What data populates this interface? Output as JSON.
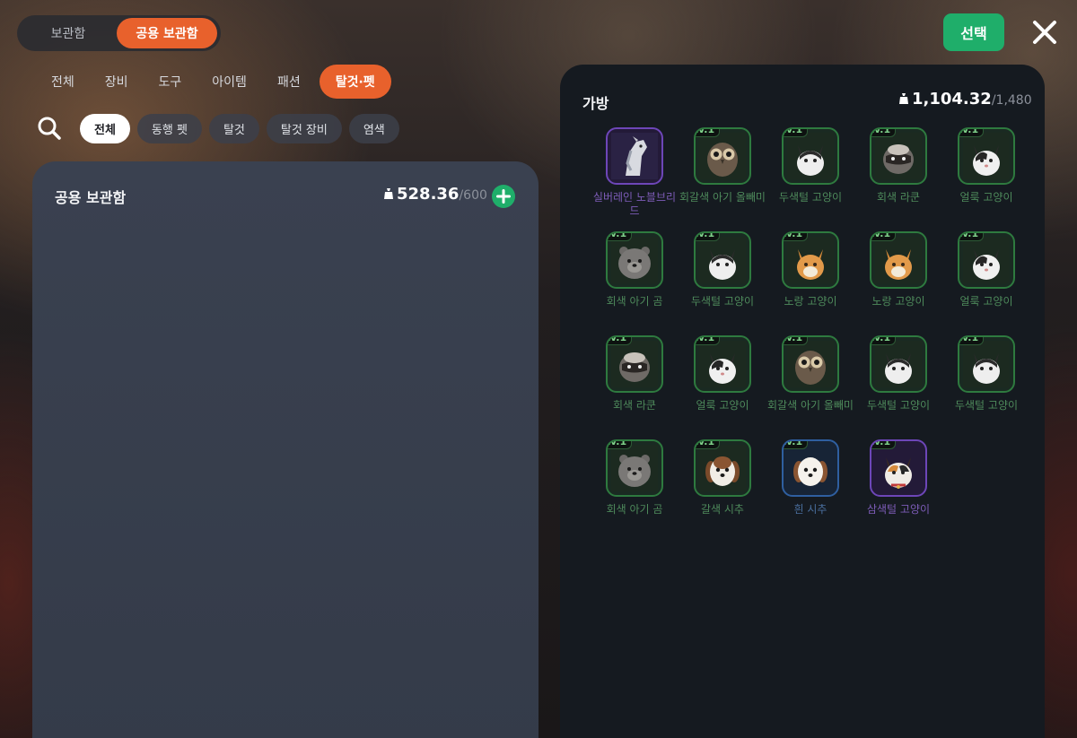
{
  "top": {
    "toggle": [
      "보관함",
      "공용 보관함"
    ],
    "select_label": "선택"
  },
  "categories": [
    "전체",
    "장비",
    "도구",
    "아이템",
    "패션",
    "탈것·펫"
  ],
  "filters": [
    "전체",
    "동행 펫",
    "탈것",
    "탈것 장비",
    "염색"
  ],
  "shared": {
    "title": "공용 보관함",
    "weight_current": "528.36",
    "weight_max": "/600"
  },
  "bag": {
    "title": "가방",
    "weight_current": "1,104.32",
    "weight_max": "/1,480",
    "items": [
      {
        "name": "실버레인 노블브리드",
        "level": "",
        "icon": "horse",
        "grade": "purple"
      },
      {
        "name": "회갈색 아기 올빼미",
        "level": "Lv.1",
        "icon": "owl",
        "grade": "green"
      },
      {
        "name": "두색털 고양이",
        "level": "Lv.1",
        "icon": "cat-bw",
        "grade": "green"
      },
      {
        "name": "회색 라쿤",
        "level": "Lv.1",
        "icon": "raccoon",
        "grade": "green"
      },
      {
        "name": "얼룩 고양이",
        "level": "Lv.1",
        "icon": "cat-calico-bw",
        "grade": "green"
      },
      {
        "name": "회색 아기 곰",
        "level": "Lv.1",
        "icon": "bear",
        "grade": "green"
      },
      {
        "name": "두색털 고양이",
        "level": "Lv.1",
        "icon": "cat-bw",
        "grade": "green"
      },
      {
        "name": "노랑 고양이",
        "level": "Lv.1",
        "icon": "cat-orange",
        "grade": "green"
      },
      {
        "name": "노랑 고양이",
        "level": "Lv.1",
        "icon": "cat-orange",
        "grade": "green"
      },
      {
        "name": "얼룩 고양이",
        "level": "Lv.1",
        "icon": "cat-calico-bw",
        "grade": "green"
      },
      {
        "name": "회색 라쿤",
        "level": "Lv.1",
        "icon": "raccoon",
        "grade": "green"
      },
      {
        "name": "얼룩 고양이",
        "level": "Lv.1",
        "icon": "cat-calico-bw",
        "grade": "green"
      },
      {
        "name": "회갈색 아기 올빼미",
        "level": "Lv.1",
        "icon": "owl",
        "grade": "green"
      },
      {
        "name": "두색털 고양이",
        "level": "Lv.1",
        "icon": "cat-bw",
        "grade": "green"
      },
      {
        "name": "두색털 고양이",
        "level": "Lv.1",
        "icon": "cat-bw",
        "grade": "green"
      },
      {
        "name": "회색 아기 곰",
        "level": "Lv.1",
        "icon": "bear",
        "grade": "green"
      },
      {
        "name": "갈색 시추",
        "level": "Lv.1",
        "icon": "shihtzu-brown",
        "grade": "green"
      },
      {
        "name": "흰 시추",
        "level": "Lv.1",
        "icon": "shihtzu-white",
        "grade": "blue"
      },
      {
        "name": "삼색털 고양이",
        "level": "Lv.1",
        "icon": "cat-calico",
        "grade": "purple"
      }
    ]
  },
  "colors": {
    "accent_orange": "#e8612c",
    "select_green": "#1fae6a",
    "grade_green": "#2e7a3f",
    "grade_blue": "#2f5fa0",
    "grade_purple": "#6d46b8"
  }
}
